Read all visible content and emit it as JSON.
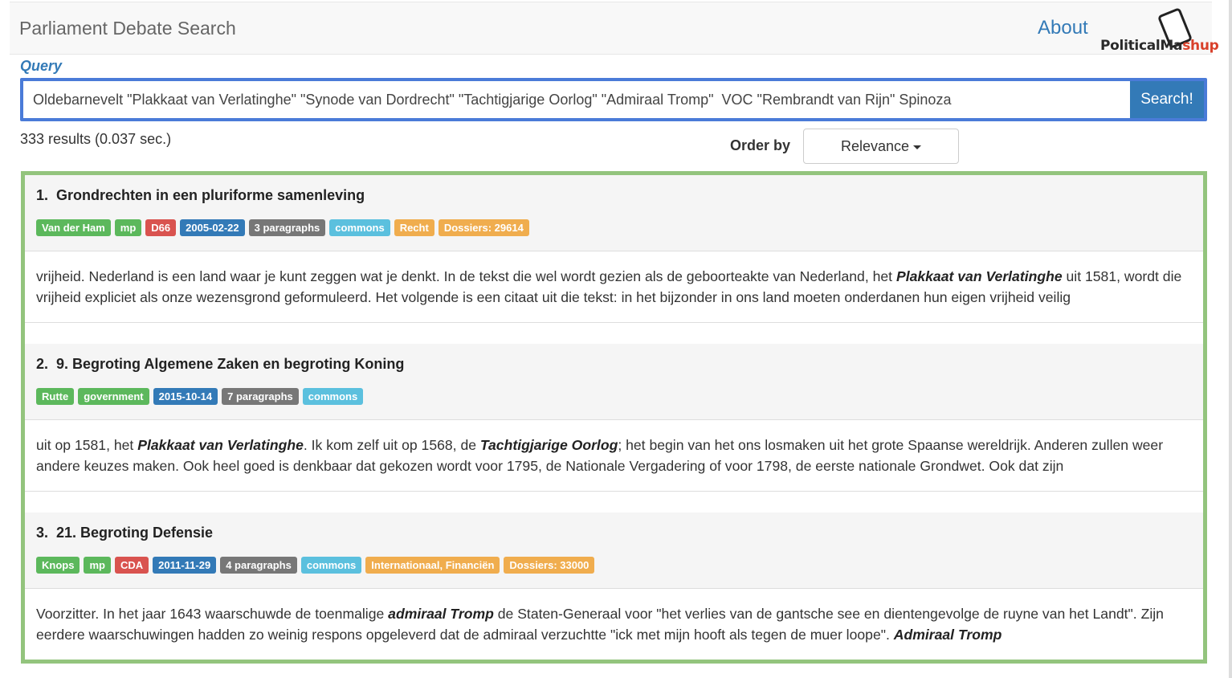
{
  "nav": {
    "brand": "Parliament Debate Search",
    "about": "About",
    "logo_part1": "PoliticalMa",
    "logo_part2": "shup"
  },
  "search": {
    "label": "Query",
    "value": "Oldebarnevelt \"Plakkaat van Verlatinghe\" \"Synode van Dordrecht\" \"Tachtigjarige Oorlog\" \"Admiraal Tromp\"  VOC \"Rembrandt van Rijn\" Spinoza",
    "button": "Search!"
  },
  "results_summary": "333 results (0.037 sec.)",
  "order": {
    "label": "Order by",
    "selected": "Relevance"
  },
  "results": [
    {
      "number": "1.",
      "title": "Grondrechten in een pluriforme samenleving",
      "tags": [
        {
          "text": "Van der Ham",
          "color": "#5cb85c"
        },
        {
          "text": "mp",
          "color": "#5cb85c"
        },
        {
          "text": "D66",
          "color": "#d9534f"
        },
        {
          "text": "2005-02-22",
          "color": "#337ab7"
        },
        {
          "text": "3 paragraphs",
          "color": "#777777"
        },
        {
          "text": "commons",
          "color": "#5bc0de"
        },
        {
          "text": "Recht",
          "color": "#f0ad4e"
        },
        {
          "text": "Dossiers: 29614",
          "color": "#f0ad4e"
        }
      ],
      "snippet": [
        {
          "t": "vrijheid. Nederland is een land waar je kunt zeggen wat je denkt. In de tekst die wel wordt gezien als de geboorteakte van Nederland, het "
        },
        {
          "t": "Plakkaat van Verlatinghe",
          "b": true
        },
        {
          "t": " uit 1581, wordt die vrijheid expliciet als onze wezensgrond geformuleerd. Het volgende is een citaat uit die tekst: in het bijzonder in ons land moeten onderdanen hun eigen vrijheid veilig"
        }
      ]
    },
    {
      "number": "2.",
      "title": "9. Begroting Algemene Zaken en begroting Koning",
      "tags": [
        {
          "text": "Rutte",
          "color": "#5cb85c"
        },
        {
          "text": "government",
          "color": "#5cb85c"
        },
        {
          "text": "2015-10-14",
          "color": "#337ab7"
        },
        {
          "text": "7 paragraphs",
          "color": "#777777"
        },
        {
          "text": "commons",
          "color": "#5bc0de"
        }
      ],
      "snippet": [
        {
          "t": "uit op 1581, het "
        },
        {
          "t": "Plakkaat van Verlatinghe",
          "b": true
        },
        {
          "t": ". Ik kom zelf uit op 1568, de "
        },
        {
          "t": "Tachtigjarige Oorlog",
          "b": true
        },
        {
          "t": "; het begin van het ons losmaken uit het grote Spaanse wereldrijk. Anderen zullen weer andere keuzes maken. Ook heel goed is denkbaar dat gekozen wordt voor 1795, de Nationale Vergadering of voor 1798, de eerste nationale Grondwet. Ook dat zijn"
        }
      ]
    },
    {
      "number": "3.",
      "title": "21. Begroting Defensie",
      "tags": [
        {
          "text": "Knops",
          "color": "#5cb85c"
        },
        {
          "text": "mp",
          "color": "#5cb85c"
        },
        {
          "text": "CDA",
          "color": "#d9534f"
        },
        {
          "text": "2011-11-29",
          "color": "#337ab7"
        },
        {
          "text": "4 paragraphs",
          "color": "#777777"
        },
        {
          "text": "commons",
          "color": "#5bc0de"
        },
        {
          "text": "Internationaal, Financiën",
          "color": "#f0ad4e"
        },
        {
          "text": "Dossiers: 33000",
          "color": "#f0ad4e"
        }
      ],
      "snippet": [
        {
          "t": "Voorzitter. In het jaar 1643 waarschuwde de toenmalige "
        },
        {
          "t": "admiraal Tromp",
          "b": true
        },
        {
          "t": " de Staten-Generaal voor \"het verlies van de gantsche see en dientengevolge de ruyne van het Landt\". Zijn eerdere waarschuwingen hadden zo weinig respons opgeleverd dat de admiraal verzuchtte \"ick met mijn hooft als tegen de muer loope\". "
        },
        {
          "t": "Admiraal Tromp",
          "b": true
        }
      ]
    }
  ]
}
